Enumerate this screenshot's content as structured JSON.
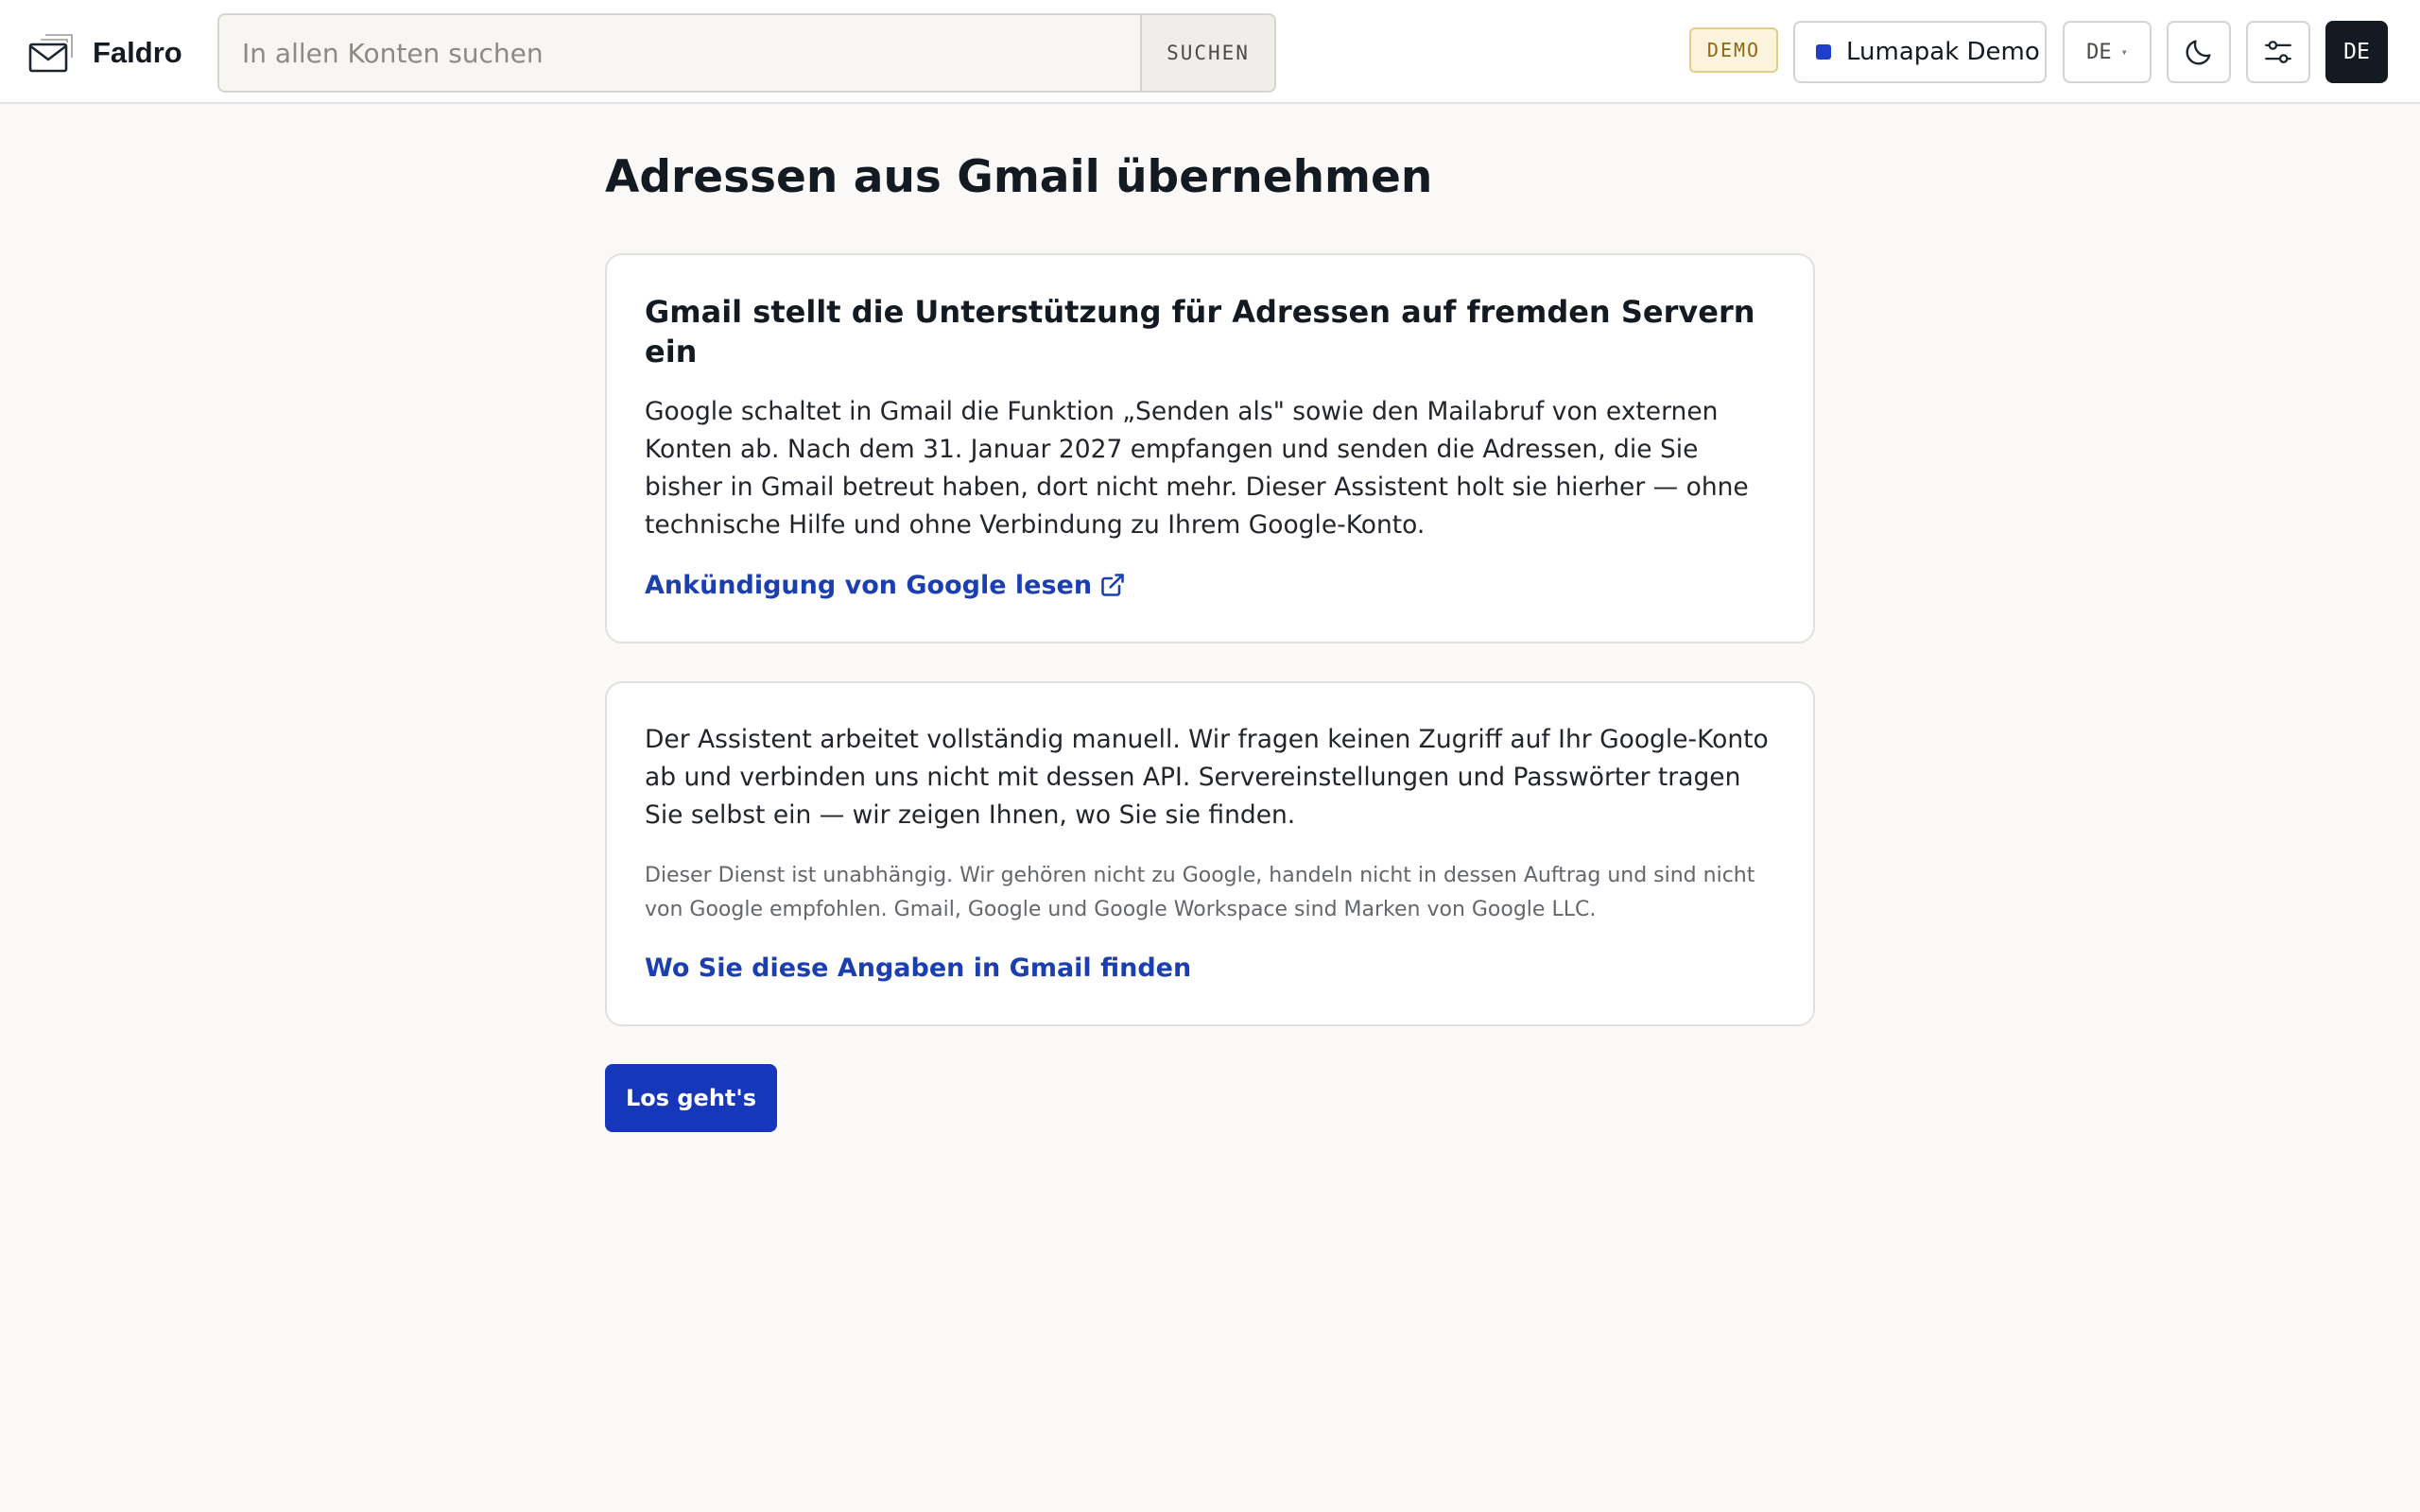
{
  "header": {
    "brand_name": "Faldro",
    "brand_icon": "envelope-icon",
    "search": {
      "placeholder": "In allen Konten suchen",
      "button_label": "SUCHEN"
    },
    "demo_badge": "DEMO",
    "account": {
      "name": "Lumapak Demo",
      "color": "#1e40c8"
    },
    "language": {
      "selected": "DE",
      "caret": "▾"
    },
    "theme_toggle_icon": "moon-icon",
    "settings_icon": "sliders-icon",
    "avatar_initials": "DE"
  },
  "main": {
    "title": "Adressen aus Gmail übernehmen",
    "notice_card": {
      "title": "Gmail stellt die Unterstützung für Adressen auf fremden Servern ein",
      "text": "Google schaltet in Gmail die Funktion „Senden als\" sowie den Mailabruf von externen Konten ab. Nach dem 31. Januar 2027 empfangen und senden die Adressen, die Sie bisher in Gmail betreut haben, dort nicht mehr. Dieser Assistent holt sie hierher — ohne technische Hilfe und ohne Verbindung zu Ihrem Google-Konto.",
      "link_label": "Ankündigung von Google lesen",
      "link_icon": "external-link-icon"
    },
    "info_card": {
      "text": "Der Assistent arbeitet vollständig manuell. Wir fragen keinen Zugriff auf Ihr Google-Konto ab und verbinden uns nicht mit dessen API. Servereinstellungen und Passwörter tragen Sie selbst ein — wir zeigen Ihnen, wo Sie sie finden.",
      "disclaimer": "Dieser Dienst ist unabhängig. Wir gehören nicht zu Google, handeln nicht in dessen Auftrag und sind nicht von Google empfohlen. Gmail, Google und Google Workspace sind Marken von Google LLC.",
      "link_label": "Wo Sie diese Angaben in Gmail finden"
    },
    "start_button": "Los geht's"
  },
  "colors": {
    "primary": "#1637ba",
    "link": "#1b3fb0",
    "background": "#faf9f7",
    "demo_badge_bg": "#fbf3dc"
  }
}
